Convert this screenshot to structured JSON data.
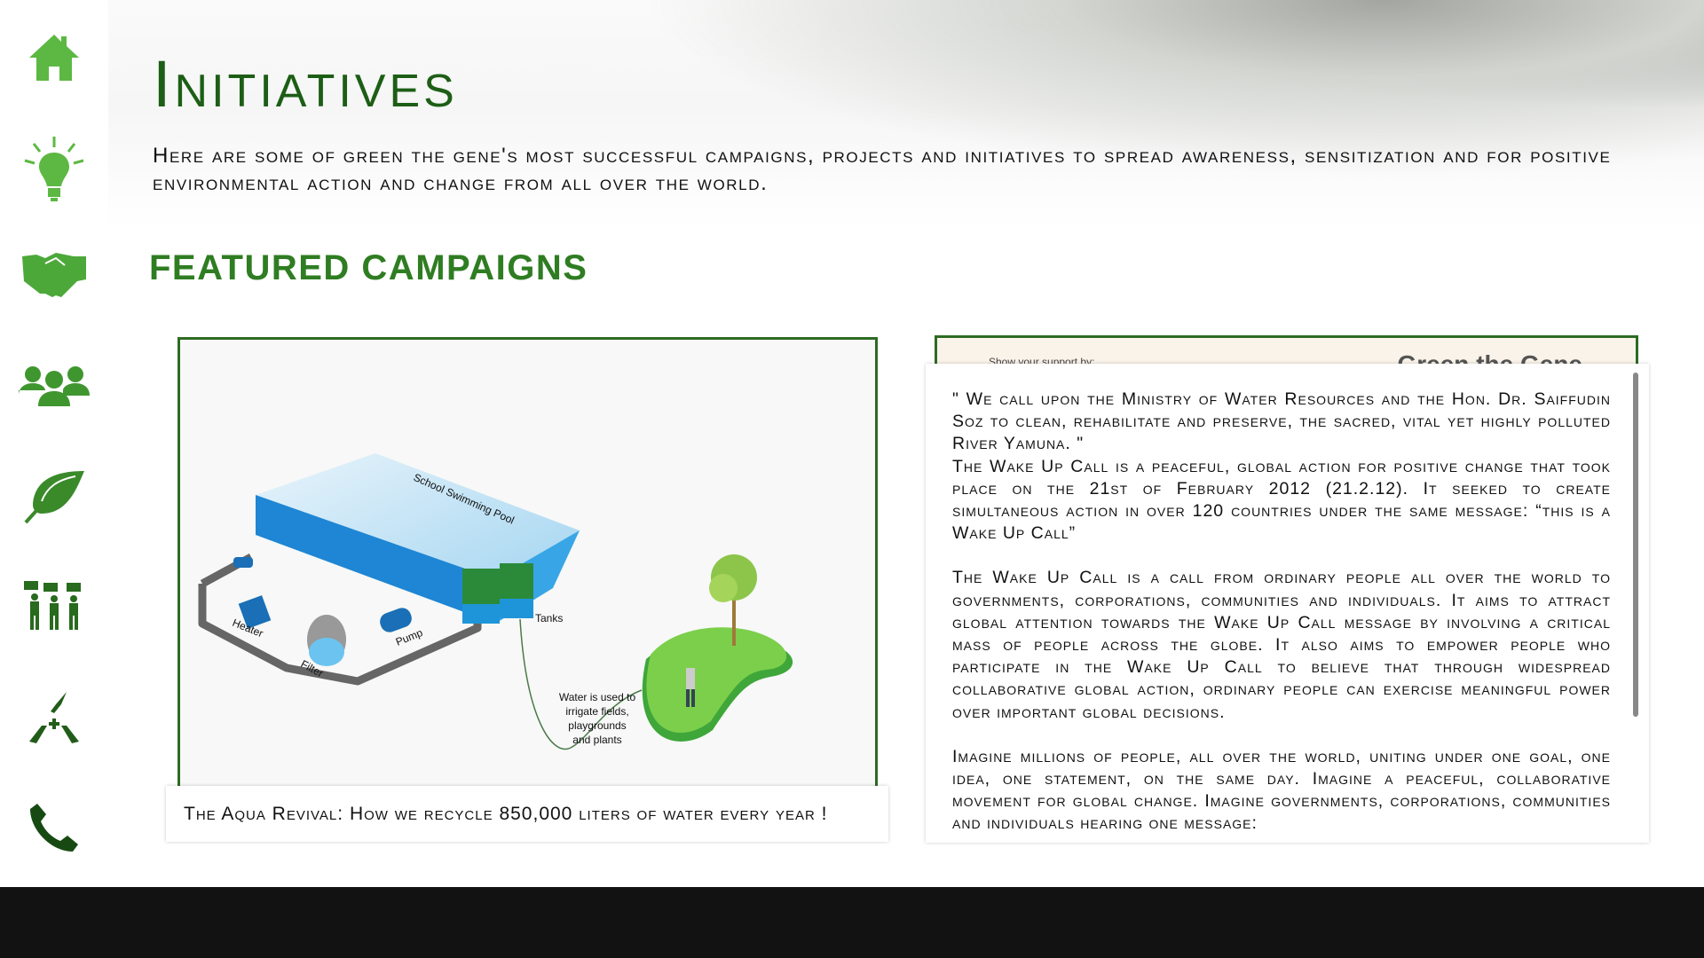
{
  "sidebar": {
    "items": [
      {
        "icon": "home-icon",
        "color": "#5cb842"
      },
      {
        "icon": "lightbulb-icon",
        "color": "#5cb842"
      },
      {
        "icon": "handshake-icon",
        "color": "#4da83a"
      },
      {
        "icon": "group-icon",
        "color": "#3f962f"
      },
      {
        "icon": "leaf-icon",
        "color": "#3a8a2a"
      },
      {
        "icon": "protest-icon",
        "color": "#286a1e"
      },
      {
        "icon": "helping-hands-icon",
        "color": "#225c1a"
      },
      {
        "icon": "phone-icon",
        "color": "#174a12"
      }
    ]
  },
  "header": {
    "title": "Initiatives",
    "intro": "Here are some of Green the Gene's most successful campaigns, projects and initiatives to spread awareness, sensitization and for positive environmental action and change from all over the world."
  },
  "section_title": "FEATURED CAMPAIGNS",
  "campaign_left": {
    "diagram_labels": {
      "pool": "School Swimming Pool",
      "tanks": "Tanks",
      "heater": "Heater",
      "filter": "Filter",
      "pump": "Pump",
      "water_line1": "Water is used to",
      "water_line2": "irrigate fields,",
      "water_line3": "playgrounds",
      "water_line4": "and plants"
    },
    "caption": "The Aqua Revival: How we recycle 850,000 liters of water every year !"
  },
  "campaign_right": {
    "back_left": "Show your support by:",
    "back_right": "Green the Gene",
    "quote": "\" We call upon the Ministry of Water Resources and the Hon. Dr. Saiffudin Soz to clean, rehabilitate and preserve, the sacred, vital yet highly polluted River Yamuna. \"",
    "para1": "The Wake Up Call is a peaceful, global action for positive change that took place on the 21st of February 2012 (21.2.12). It seeked to create simultaneous action in over 120 countries under the same message: “this is a Wake Up Call”",
    "para2": "The Wake Up Call is a call from ordinary people all over the world to governments, corporations, communities and individuals. It aims to attract global attention towards the Wake Up Call message by involving a critical mass of people across the globe. It also aims to empower people who participate in the Wake Up Call to believe that through widespread collaborative global action, ordinary people can exercise meaningful power over important global decisions.",
    "para3": "Imagine millions of people, all over the world, uniting under one goal, one idea, one statement, on the same day. Imagine a peaceful, collaborative movement for global change. Imagine governments, corporations, communities and individuals hearing one message:"
  },
  "colors": {
    "title": "#1d5e16",
    "section": "#2f7d22",
    "border": "#2d6b22",
    "footer": "#121212"
  }
}
